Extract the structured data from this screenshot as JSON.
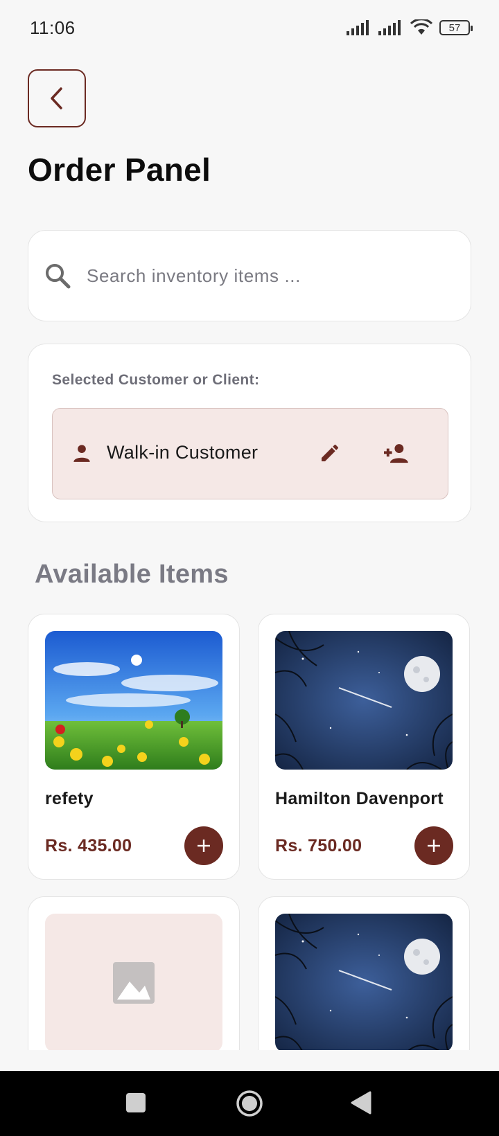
{
  "status_bar": {
    "time": "11:06",
    "battery": "57",
    "icons": [
      "signal-icon",
      "signal-icon",
      "wifi-icon",
      "battery-icon"
    ]
  },
  "header": {
    "back_icon": "chevron-left-icon",
    "title": "Order Panel"
  },
  "search": {
    "placeholder": "Search inventory items ...",
    "value": "",
    "icon": "search-icon"
  },
  "customer": {
    "label": "Selected Customer or Client:",
    "name": "Walk-in Customer",
    "icons": [
      "person-icon",
      "edit-icon",
      "person-add-icon"
    ]
  },
  "available": {
    "title": "Available Items",
    "items": [
      {
        "name": "refety",
        "price": "Rs. 435.00",
        "image": "landscape-image"
      },
      {
        "name": "Hamilton Davenport",
        "price": "Rs. 750.00",
        "image": "night-sky-image"
      },
      {
        "name": "",
        "price": "",
        "image": "placeholder-image"
      },
      {
        "name": "",
        "price": "",
        "image": "night-sky-image"
      }
    ]
  },
  "colors": {
    "accent": "#6b2a22",
    "customer_bg": "#f5e8e6",
    "background": "#f7f7f7"
  }
}
